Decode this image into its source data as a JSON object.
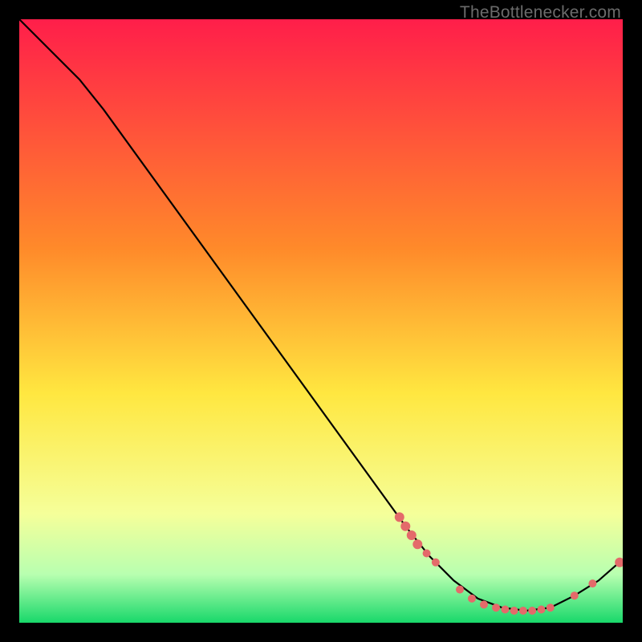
{
  "watermark": "TheBottlenecker.com",
  "colors": {
    "bg": "#000000",
    "line": "#000000",
    "marker": "#e46a6a",
    "grad_top": "#ff1e4a",
    "grad_mid1": "#ff8a2a",
    "grad_mid2": "#ffe740",
    "grad_low1": "#f5ff9a",
    "grad_low2": "#b8ffb0",
    "grad_bottom": "#18d86a"
  },
  "chart_data": {
    "type": "line",
    "title": "",
    "xlabel": "",
    "ylabel": "",
    "xlim": [
      0,
      100
    ],
    "ylim": [
      0,
      100
    ],
    "curve_xy": [
      [
        0,
        100
      ],
      [
        6,
        94
      ],
      [
        10,
        90
      ],
      [
        14,
        85
      ],
      [
        64,
        16
      ],
      [
        68,
        11
      ],
      [
        72,
        7
      ],
      [
        76,
        4
      ],
      [
        80,
        2.5
      ],
      [
        84,
        2
      ],
      [
        88,
        2.5
      ],
      [
        92,
        4.5
      ],
      [
        96,
        7
      ],
      [
        100,
        10.5
      ]
    ],
    "markers_xy": [
      [
        63,
        17.5
      ],
      [
        64,
        16
      ],
      [
        65,
        14.5
      ],
      [
        66,
        13
      ],
      [
        67.5,
        11.5
      ],
      [
        69,
        10
      ],
      [
        73,
        5.5
      ],
      [
        75,
        4
      ],
      [
        77,
        3
      ],
      [
        79,
        2.5
      ],
      [
        80.5,
        2.2
      ],
      [
        82,
        2
      ],
      [
        83.5,
        2
      ],
      [
        85,
        2
      ],
      [
        86.5,
        2.2
      ],
      [
        88,
        2.5
      ],
      [
        92,
        4.5
      ],
      [
        95,
        6.5
      ],
      [
        99.5,
        10
      ]
    ],
    "marker_radius_px": [
      6,
      6,
      6,
      6,
      5,
      5,
      5,
      5,
      5,
      5,
      5,
      5,
      5,
      5,
      5,
      5,
      5,
      5,
      6
    ]
  }
}
